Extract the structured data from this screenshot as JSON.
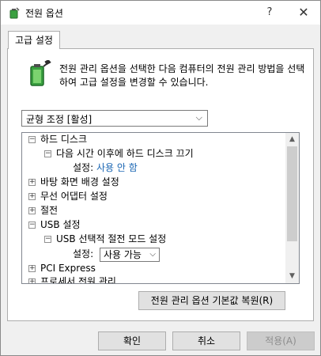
{
  "window": {
    "title": "전원 옵션",
    "help_label": "?",
    "close_label": "✕"
  },
  "tab": {
    "label": "고급 설정"
  },
  "description": "전원 관리 옵션을 선택한 다음 컴퓨터의 전원 관리 방법을 선택하여 고급 설정을 변경할 수 있습니다.",
  "plan_select": {
    "value": "균형 조정 [활성]",
    "arrow": "⌵"
  },
  "tree": {
    "items": [
      {
        "expander": "−",
        "label": "하드 디스크"
      },
      {
        "expander": "−",
        "label": "다음 시간 이후에 하드 디스크 끄기"
      },
      {
        "label": "설정:",
        "value": "사용 안 함"
      },
      {
        "expander": "+",
        "label": "바탕 화면 배경 설정"
      },
      {
        "expander": "+",
        "label": "무선 어댑터 설정"
      },
      {
        "expander": "+",
        "label": "절전"
      },
      {
        "expander": "−",
        "label": "USB 설정"
      },
      {
        "expander": "−",
        "label": "USB 선택적 절전 모드 설정"
      },
      {
        "label": "설정:",
        "select_value": "사용 가능"
      },
      {
        "expander": "+",
        "label": "PCI Express"
      },
      {
        "expander": "+",
        "label": "프로세서 전원 관리"
      }
    ],
    "scroll_up": "▲",
    "scroll_down": "▼"
  },
  "buttons": {
    "restore": "전원 관리 옵션 기본값 복원(R)",
    "ok": "확인",
    "cancel": "취소",
    "apply": "적용(A)"
  },
  "colors": {
    "accent": "#1a66b3",
    "battery": "#3aa040"
  }
}
